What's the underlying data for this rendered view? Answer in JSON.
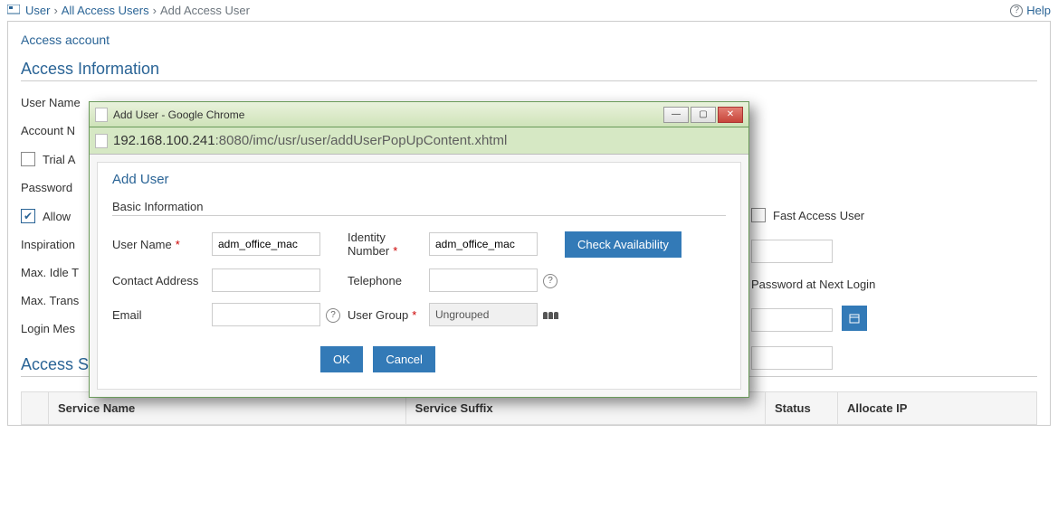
{
  "breadcrumb": {
    "user": "User",
    "all_access": "All Access Users",
    "add_access": "Add Access User"
  },
  "help_label": "Help",
  "panel": {
    "title": "Access account"
  },
  "sections": {
    "access_info": "Access Information",
    "access_service": "Access Service"
  },
  "bg_form": {
    "user_name": "User Name",
    "account_n": "Account N",
    "trial_a": "Trial A",
    "password": "Password",
    "allow": "Allow",
    "inspiration": "Inspiration",
    "max_idle": "Max. Idle T",
    "max_trans": "Max. Trans",
    "login_mes": "Login Mes",
    "fast_access": "Fast Access User",
    "pw_next_login": "Password at Next Login"
  },
  "svc_table": {
    "service_name": "Service Name",
    "service_suffix": "Service Suffix",
    "status": "Status",
    "allocate_ip": "Allocate IP"
  },
  "modal": {
    "window_title": "Add User - Google Chrome",
    "url_host": "192.168.100.241",
    "url_rest": ":8080/imc/usr/user/addUserPopUpContent.xhtml",
    "card_title": "Add User",
    "basic_info": "Basic Information",
    "labels": {
      "user_name": "User Name",
      "identity_number": "Identity Number",
      "contact_address": "Contact Address",
      "telephone": "Telephone",
      "email": "Email",
      "user_group": "User Group"
    },
    "values": {
      "user_name": "adm_office_mac",
      "identity_number": "adm_office_mac",
      "contact_address": "",
      "telephone": "",
      "email": "",
      "user_group": "Ungrouped"
    },
    "buttons": {
      "check": "Check Availability",
      "ok": "OK",
      "cancel": "Cancel"
    }
  }
}
